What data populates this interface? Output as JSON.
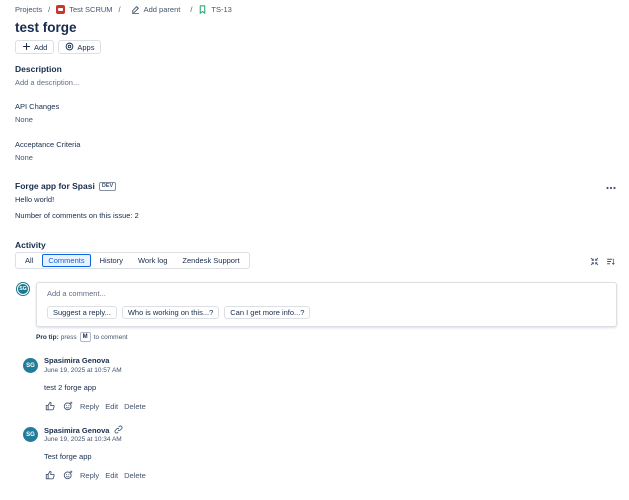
{
  "breadcrumb": {
    "projects": "Projects",
    "project": "Test SCRUM",
    "add_parent": "Add parent",
    "issue_key": "TS-13",
    "separator": "/"
  },
  "issue": {
    "title": "test forge"
  },
  "toolbar": {
    "add_label": "Add",
    "apps_label": "Apps"
  },
  "description": {
    "heading": "Description",
    "placeholder": "Add a description..."
  },
  "fields": [
    {
      "label": "API Changes",
      "value": "None"
    },
    {
      "label": "Acceptance Criteria",
      "value": "None"
    }
  ],
  "forge_panel": {
    "title": "Forge app for Spasi",
    "badge": "DEV",
    "line1": "Hello world!",
    "line2": "Number of comments on this issue: 2"
  },
  "activity": {
    "heading": "Activity",
    "tabs": [
      "All",
      "Comments",
      "History",
      "Work log",
      "Zendesk Support"
    ],
    "active_tab": "Comments"
  },
  "composer": {
    "avatar": "SG",
    "placeholder": "Add a comment...",
    "suggestions": [
      "Suggest a reply...",
      "Who is working on this...?",
      "Can I get more info...?"
    ],
    "protip_bold": "Pro tip:",
    "protip_pre": "press",
    "protip_key": "M",
    "protip_post": "to comment"
  },
  "comments": [
    {
      "initials": "SG",
      "author": "Spasimira Genova",
      "time": "June 19, 2025 at 10:57 AM",
      "text": "test 2 forge app",
      "reply": "Reply",
      "edit": "Edit",
      "delete": "Delete"
    },
    {
      "initials": "SG",
      "author": "Spasimira Genova",
      "time": "June 19, 2025 at 10:34 AM",
      "text": "Test forge app",
      "reply": "Reply",
      "edit": "Edit",
      "delete": "Delete"
    }
  ],
  "colors": {
    "accent": "#0c66e4",
    "text": "#172b4d",
    "subtle": "#44546f",
    "avatar": "#1d7a8c",
    "project": "#c9372c"
  },
  "icons": {
    "add": "plus-icon",
    "apps": "apps-icon",
    "edit": "edit-icon",
    "issue": "bookmark-icon",
    "more": "more-icon",
    "collapse": "collapse-icon",
    "sort": "sort-icon",
    "like": "thumbs-up-icon",
    "reaction": "add-reaction-icon",
    "link": "link-icon"
  }
}
